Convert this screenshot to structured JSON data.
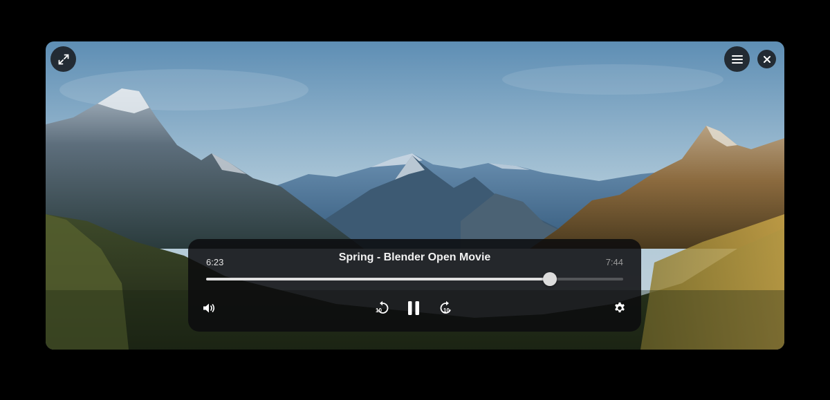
{
  "player": {
    "title": "Spring - Blender Open Movie",
    "elapsed": "6:23",
    "duration": "7:44",
    "progress_fraction": 0.825,
    "state": "playing",
    "rewind_seconds": "10",
    "forward_seconds": "10"
  },
  "icons": {
    "fullscreen": "expand-arrows-icon",
    "menu": "hamburger-menu-icon",
    "close": "close-icon",
    "volume": "speaker-icon",
    "rewind": "rewind-10-icon",
    "pause": "pause-icon",
    "forward": "forward-10-icon",
    "settings": "gear-icon"
  },
  "colors": {
    "controls_bg": "#0c0c0e",
    "seek_fill": "#e0e0e0",
    "seek_track": "#4a4a4a",
    "title_text": "#f2f2f2",
    "duration_text": "#9a9a9a"
  }
}
